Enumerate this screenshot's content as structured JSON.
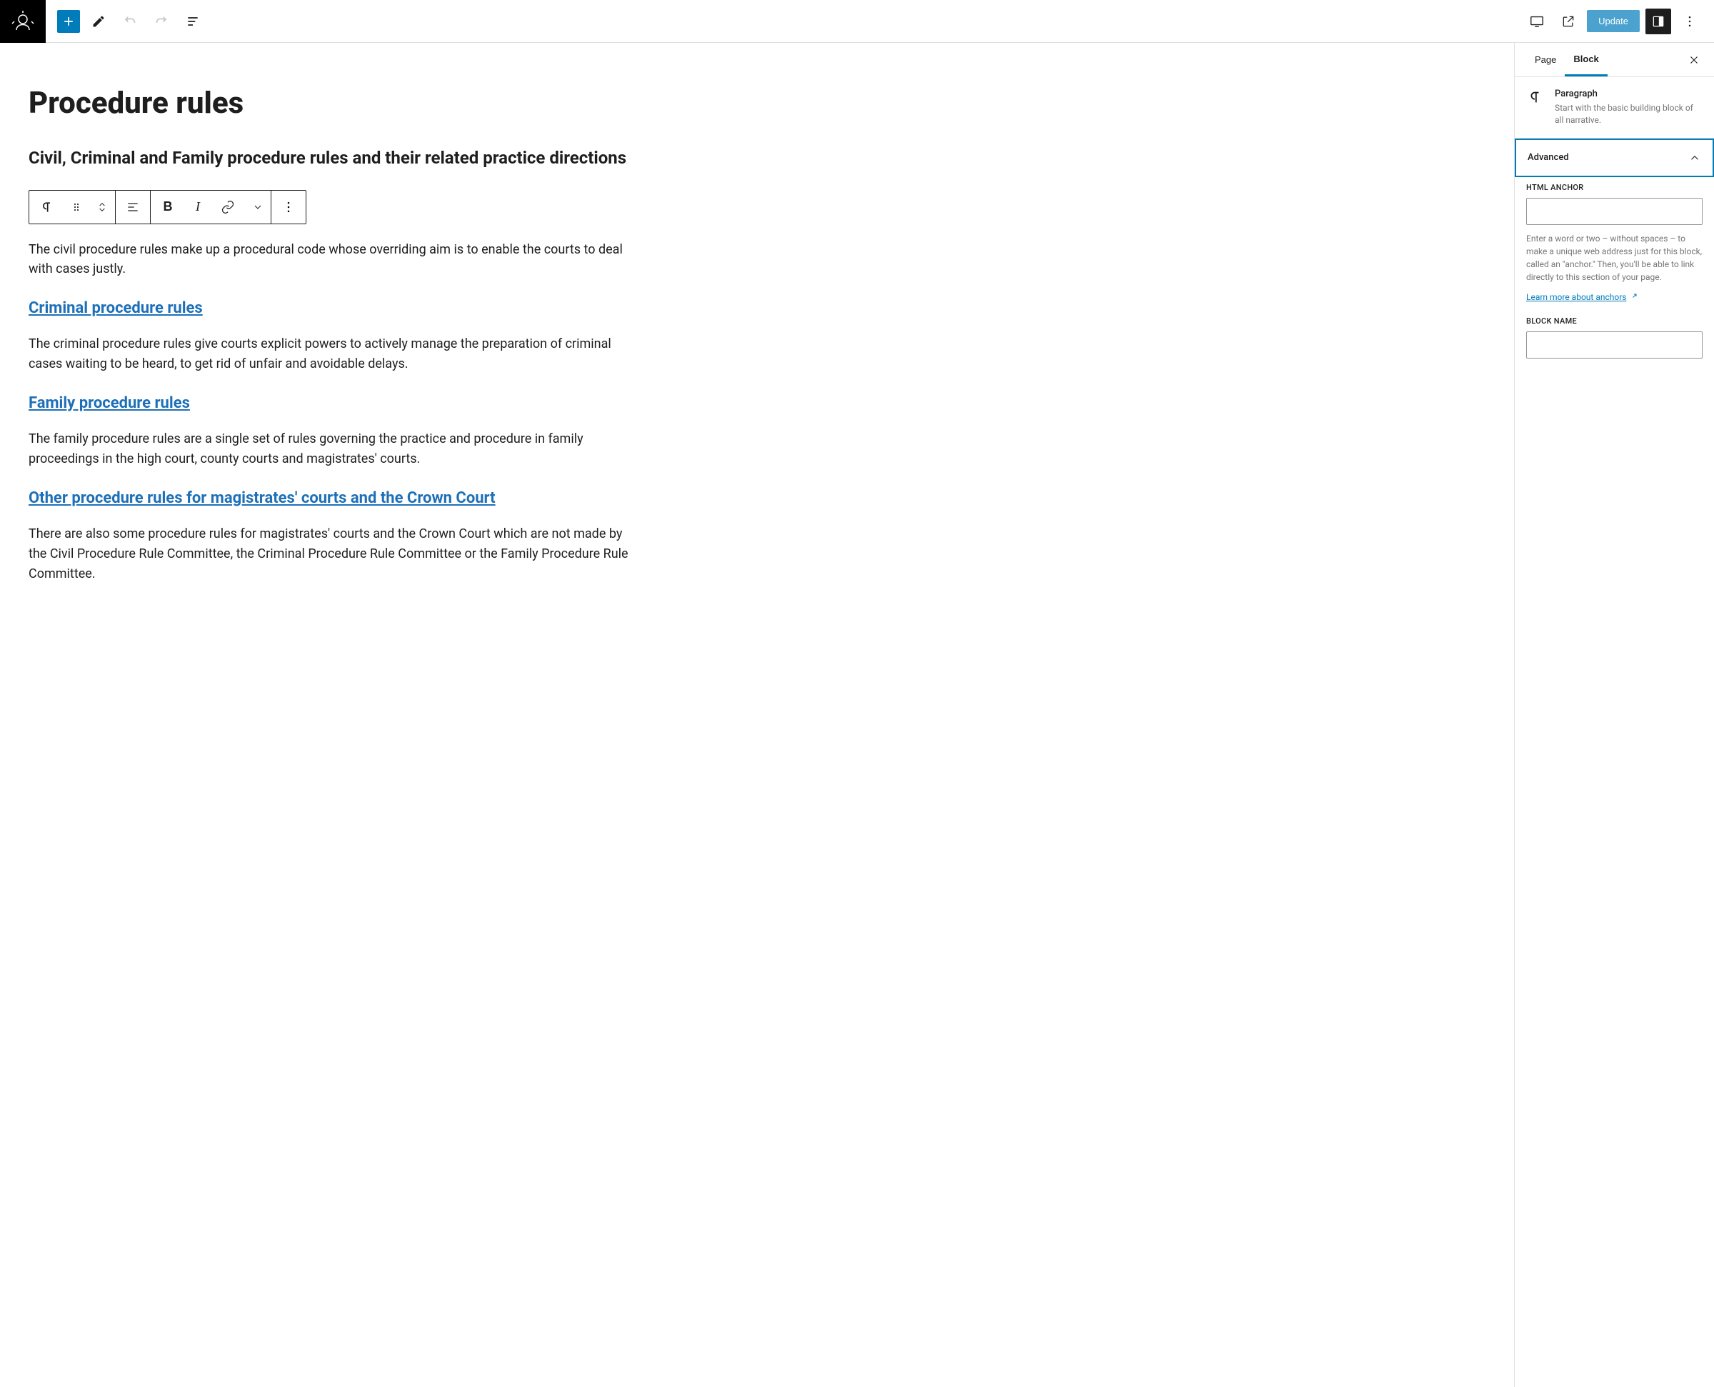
{
  "toolbar": {
    "update_label": "Update"
  },
  "content": {
    "title": "Procedure rules",
    "subtitle": "Civil, Criminal and Family procedure rules and their related practice directions",
    "para1": "The civil procedure rules make up a procedural code whose overriding aim is to enable the courts to deal with cases justly.",
    "h3_1": "Criminal procedure rules",
    "para2": "The criminal procedure rules give courts explicit powers to actively manage the preparation of criminal cases waiting to be heard, to get rid of unfair and avoidable delays.",
    "h3_2": "Family procedure rules",
    "para3": "The family procedure rules are a single set of rules governing the practice and procedure in family proceedings in the high court, county courts and magistrates' courts.",
    "h3_3": "Other procedure rules for magistrates' courts and the Crown Court",
    "para4": "There are also some procedure rules for magistrates' courts and the Crown Court which are not made by the Civil Procedure Rule Committee, the Criminal Procedure Rule Committee or the Family Procedure Rule Committee."
  },
  "sidebar": {
    "tab_page": "Page",
    "tab_block": "Block",
    "block_name": "Paragraph",
    "block_desc": "Start with the basic building block of all narrative.",
    "panel_advanced": "Advanced",
    "label_anchor": "HTML ANCHOR",
    "help_anchor": "Enter a word or two – without spaces – to make a unique web address just for this block, called an \"anchor.\" Then, you'll be able to link directly to this section of your page.",
    "link_anchor": "Learn more about anchors",
    "label_blockname": "BLOCK NAME"
  }
}
